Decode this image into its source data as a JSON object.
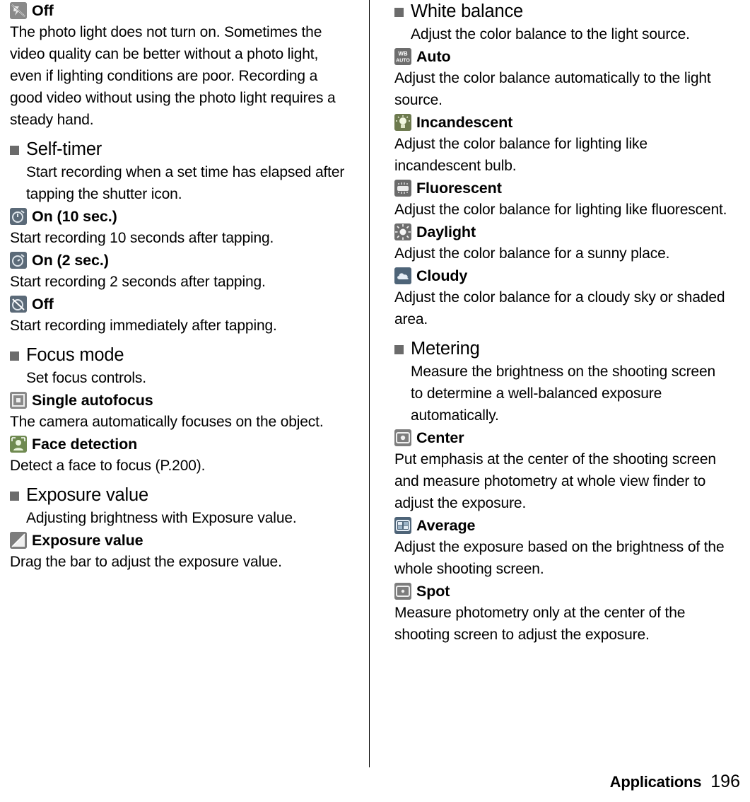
{
  "footer": {
    "section_label": "Applications",
    "page_number": "196"
  },
  "left_column": {
    "top_option": {
      "icon": "photo-light-off-icon",
      "label": "Off",
      "description": "The photo light does not turn on. Sometimes the video quality can be better without a photo light, even if lighting conditions are poor. Recording a good video without using the photo light requires a steady hand."
    },
    "sections": [
      {
        "title": "Self-timer",
        "description": "Start recording when a set time has elapsed after tapping the shutter icon.",
        "options": [
          {
            "icon": "self-timer-10sec-icon",
            "label": "On (10 sec.)",
            "description": "Start recording 10 seconds after tapping."
          },
          {
            "icon": "self-timer-2sec-icon",
            "label": "On (2 sec.)",
            "description": "Start recording 2 seconds after tapping."
          },
          {
            "icon": "self-timer-off-icon",
            "label": "Off",
            "description": "Start recording immediately after tapping."
          }
        ]
      },
      {
        "title": "Focus mode",
        "description": "Set focus controls.",
        "options": [
          {
            "icon": "single-autofocus-icon",
            "label": "Single autofocus",
            "description": "The camera automatically focuses on the object."
          },
          {
            "icon": "face-detection-icon",
            "label": "Face detection",
            "description": "Detect a face to focus (P.200)."
          }
        ]
      },
      {
        "title": "Exposure value",
        "description": "Adjusting brightness with Exposure value.",
        "options": [
          {
            "icon": "exposure-value-icon",
            "label": "Exposure value",
            "description": "Drag the bar to adjust the exposure value."
          }
        ]
      }
    ]
  },
  "right_column": {
    "sections": [
      {
        "title": "White balance",
        "description": "Adjust the color balance to the light source.",
        "options": [
          {
            "icon": "white-balance-auto-icon",
            "label": "Auto",
            "description": "Adjust the color balance automatically to the light source."
          },
          {
            "icon": "incandescent-icon",
            "label": "Incandescent",
            "description": "Adjust the color balance for lighting like incandescent bulb."
          },
          {
            "icon": "fluorescent-icon",
            "label": "Fluorescent",
            "description": "Adjust the color balance for lighting like fluorescent."
          },
          {
            "icon": "daylight-icon",
            "label": "Daylight",
            "description": "Adjust the color balance for a sunny place."
          },
          {
            "icon": "cloudy-icon",
            "label": "Cloudy",
            "description": "Adjust the color balance for a cloudy sky or shaded area."
          }
        ]
      },
      {
        "title": "Metering",
        "description": "Measure the brightness on the shooting screen to determine a well-balanced exposure automatically.",
        "options": [
          {
            "icon": "metering-center-icon",
            "label": "Center",
            "description": "Put emphasis at the center of the shooting screen and measure photometry at whole view finder to adjust the exposure."
          },
          {
            "icon": "metering-average-icon",
            "label": "Average",
            "description": "Adjust the exposure based on the brightness of the whole shooting screen."
          },
          {
            "icon": "metering-spot-icon",
            "label": "Spot",
            "description": "Measure photometry only at the center of the shooting screen to adjust the exposure."
          }
        ]
      }
    ]
  }
}
